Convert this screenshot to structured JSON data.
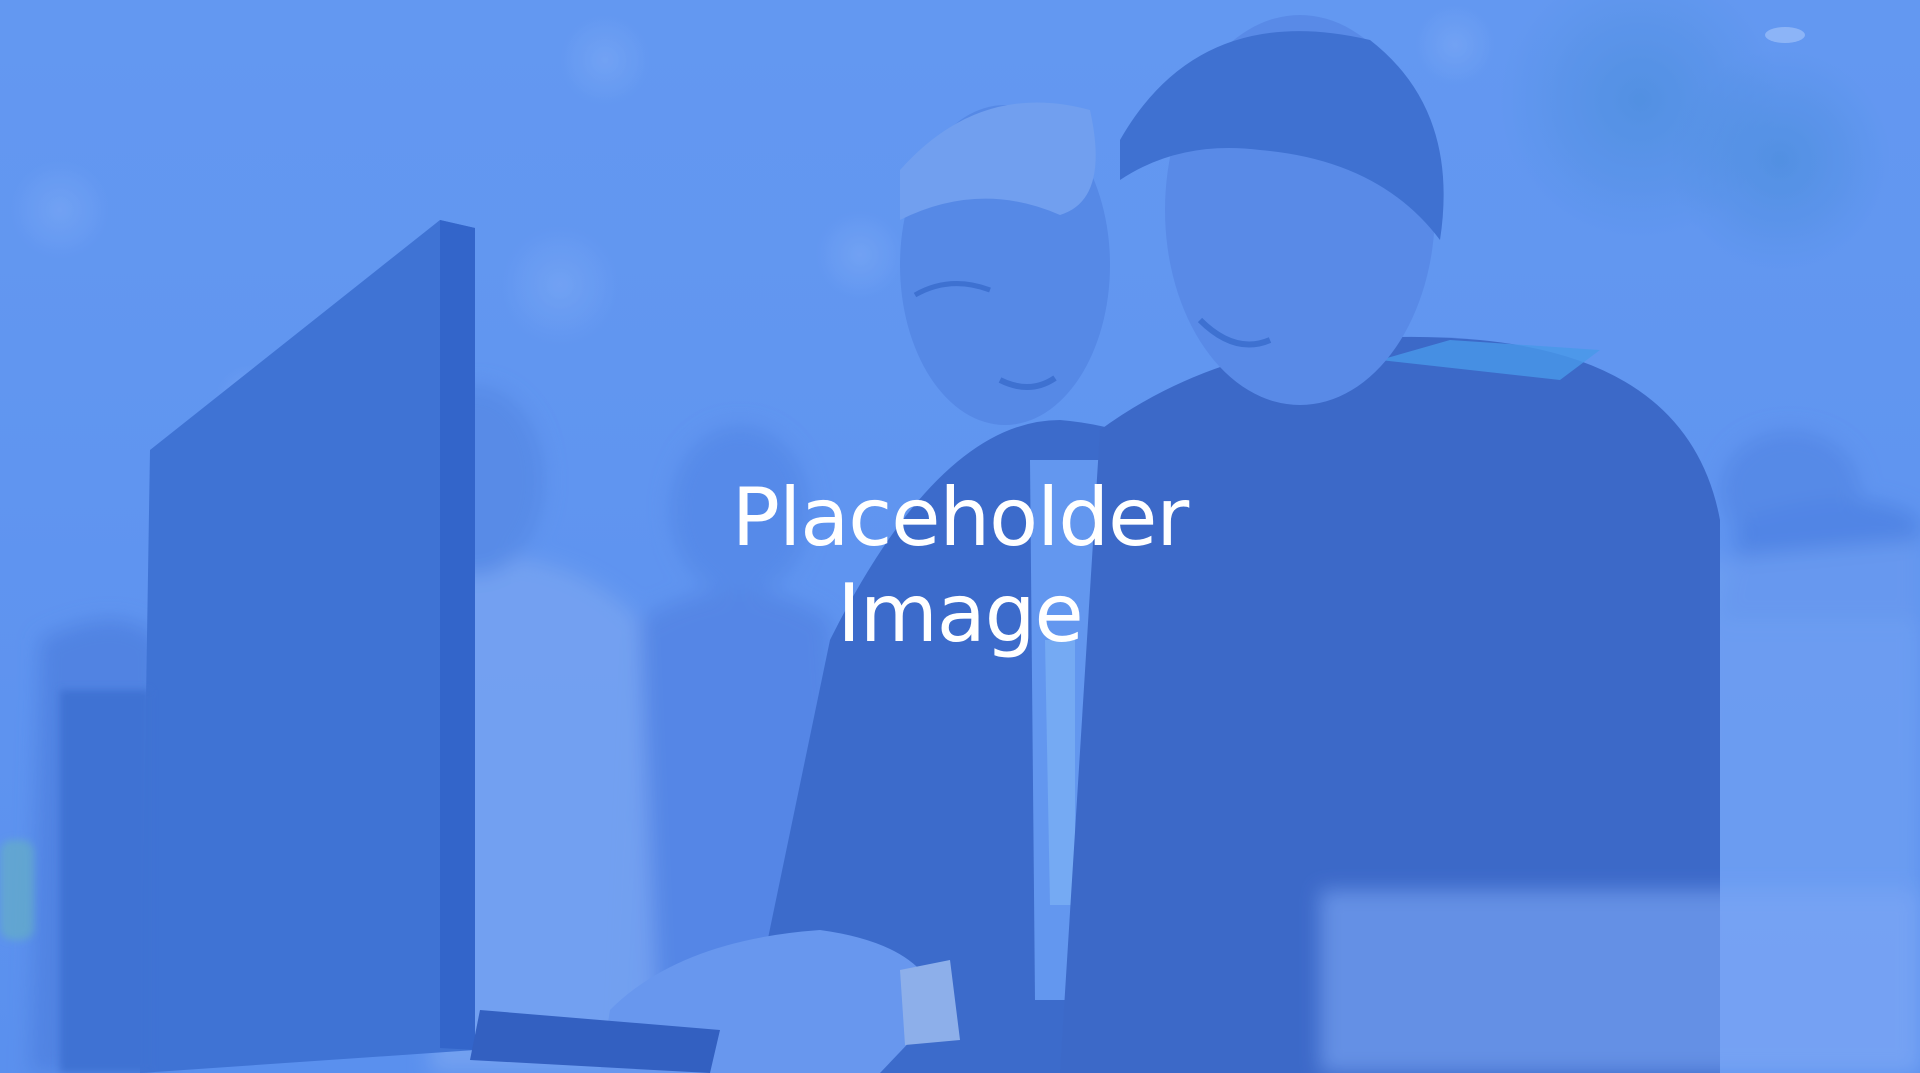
{
  "placeholder": {
    "line1": "Placeholder",
    "line2": "Image"
  },
  "colors": {
    "background": "#6497f0",
    "overlay_dark": "#4a7fe0",
    "text": "#ffffff"
  },
  "photo_subject": "two-people-at-computer-photo"
}
